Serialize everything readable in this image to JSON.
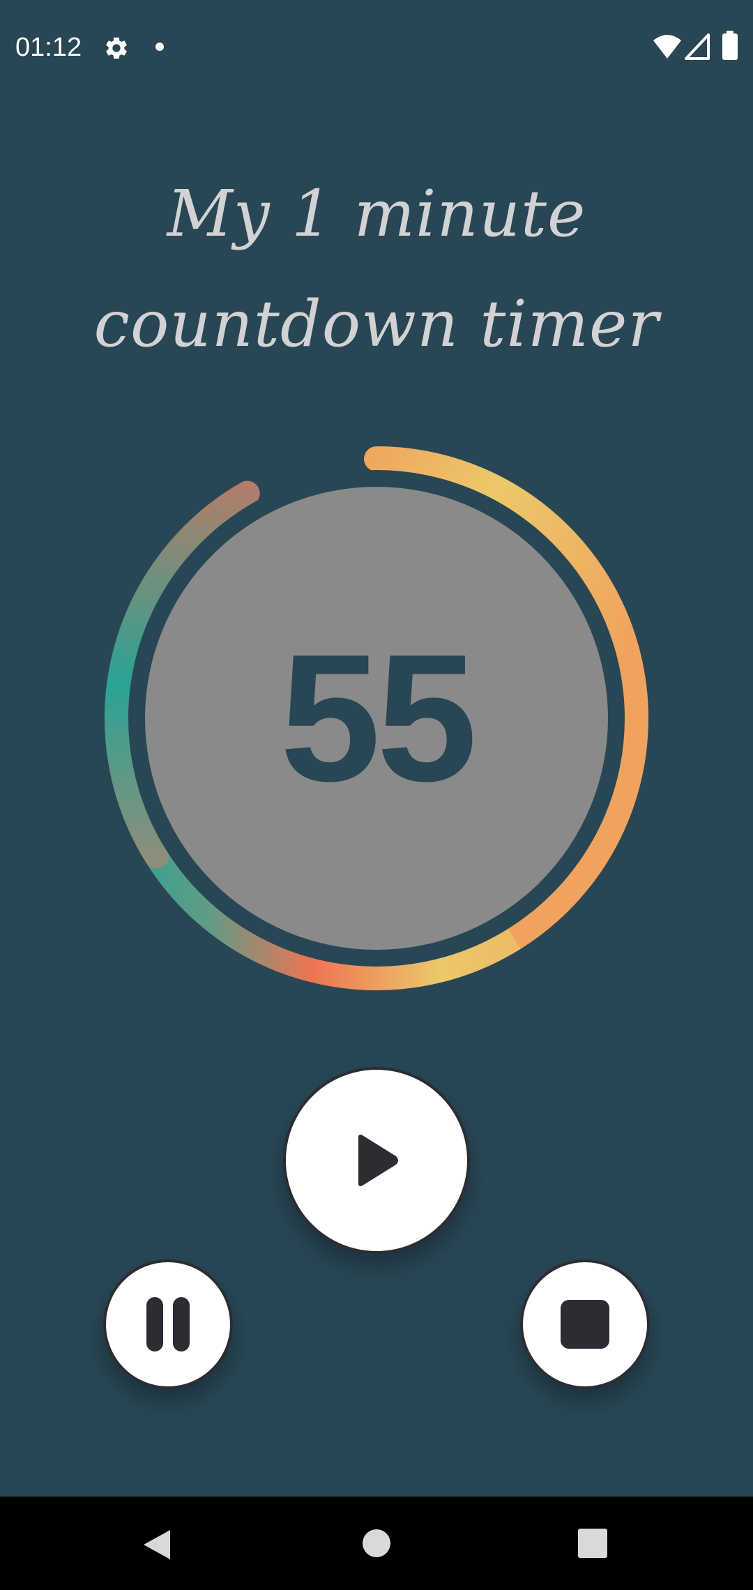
{
  "status_bar": {
    "time": "01:12",
    "icons": [
      "gear-icon",
      "notification-dot-icon",
      "wifi-icon",
      "signal-icon",
      "battery-icon"
    ]
  },
  "title": {
    "line1": "My 1 minute",
    "line2": "countdown timer"
  },
  "timer": {
    "value": "55",
    "progress_remaining": 0.917,
    "colors": {
      "track": "#284654",
      "face": "#8a8a8a",
      "gradient": [
        "#f0a35e",
        "#ebc96a",
        "#ee7453",
        "#2aa394",
        "#b07e6a"
      ]
    }
  },
  "controls": {
    "play": "play-icon",
    "pause": "pause-icon",
    "stop": "stop-icon"
  },
  "nav_bar": {
    "icons": [
      "back-icon",
      "home-icon",
      "recents-icon"
    ]
  },
  "colors": {
    "background": "#284654",
    "title_text": "#d2d2d4",
    "button_bg": "#ffffff",
    "button_icon": "#2b2d33"
  }
}
